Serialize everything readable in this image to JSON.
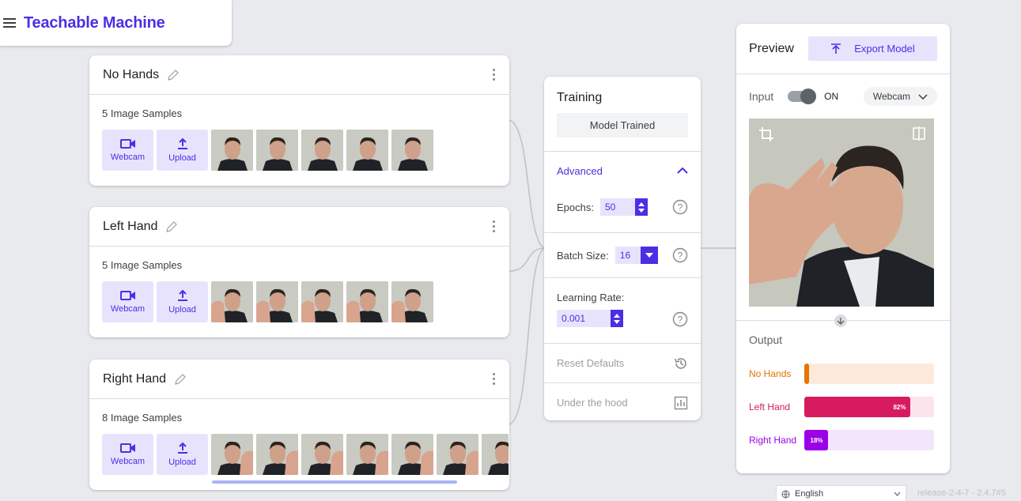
{
  "app": {
    "title": "Teachable Machine"
  },
  "classes": [
    {
      "name": "No Hands",
      "samples_label": "5 Image Samples",
      "webcam_label": "Webcam",
      "upload_label": "Upload",
      "thumb_count": 5
    },
    {
      "name": "Left Hand",
      "samples_label": "5 Image Samples",
      "webcam_label": "Webcam",
      "upload_label": "Upload",
      "thumb_count": 5
    },
    {
      "name": "Right Hand",
      "samples_label": "8 Image Samples",
      "webcam_label": "Webcam",
      "upload_label": "Upload",
      "thumb_count": 8
    }
  ],
  "training": {
    "title": "Training",
    "status_button": "Model Trained",
    "advanced_label": "Advanced",
    "epochs_label": "Epochs:",
    "epochs_value": "50",
    "batch_label": "Batch Size:",
    "batch_value": "16",
    "lr_label": "Learning Rate:",
    "lr_value": "0.001",
    "reset_label": "Reset Defaults",
    "hood_label": "Under the hood"
  },
  "preview": {
    "title": "Preview",
    "export_label": "Export Model",
    "input_label": "Input",
    "toggle_state": "ON",
    "source_select": "Webcam",
    "output_title": "Output",
    "outputs": [
      {
        "label": "No Hands",
        "percent": 0,
        "percent_text": "",
        "color": "#e37400",
        "track": "#fde9dc"
      },
      {
        "label": "Left Hand",
        "percent": 82,
        "percent_text": "82%",
        "color": "#d81b60",
        "track": "#fce4ec"
      },
      {
        "label": "Right Hand",
        "percent": 18,
        "percent_text": "18%",
        "color": "#9c00e6",
        "track": "#f3e5fc"
      }
    ]
  },
  "footer": {
    "language": "English",
    "release": "release-2-4-7 - 2.4.7#5"
  },
  "colors": {
    "accent": "#4d2ee4",
    "accent_light": "#e8e3fd"
  }
}
